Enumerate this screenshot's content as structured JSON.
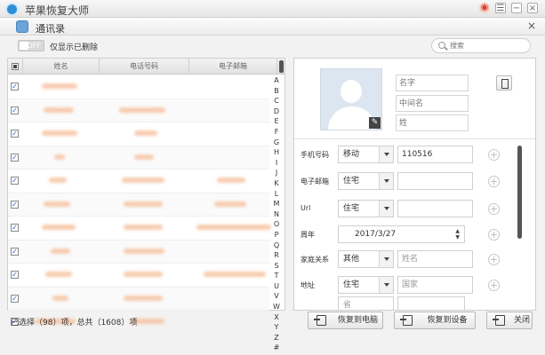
{
  "app": {
    "title": "苹果恢复大师",
    "logo": "app-logo-icon"
  },
  "titlebar": {
    "icons": [
      "weibo-icon",
      "feedback-icon",
      "minimize-icon",
      "close-icon"
    ]
  },
  "subheader": {
    "title": "通讯录",
    "close": "×"
  },
  "filter": {
    "toggle_text": "OFF",
    "label": "仅显示已删除",
    "search_placeholder": "搜索"
  },
  "list": {
    "columns": [
      "姓名",
      "电话号码",
      "电子邮箱"
    ],
    "alphabet": [
      "A",
      "B",
      "C",
      "D",
      "E",
      "F",
      "G",
      "H",
      "I",
      "J",
      "K",
      "L",
      "M",
      "N",
      "O",
      "P",
      "Q",
      "R",
      "S",
      "T",
      "U",
      "V",
      "W",
      "X",
      "Y",
      "Z",
      "#"
    ],
    "rows_checked": [
      true,
      true,
      true,
      true,
      true,
      true,
      true,
      true,
      true,
      true,
      true
    ]
  },
  "status": {
    "selection_text": "已选择（98）项，总共（1608）项"
  },
  "buttons": {
    "restore_pc": "恢复到电脑",
    "restore_device": "恢复到设备",
    "close": "关闭"
  },
  "detail": {
    "name_placeholders": {
      "first": "名字",
      "middle": "中间名",
      "last": "姓"
    },
    "phone": {
      "label": "手机号码",
      "type": "移动",
      "value": "110516"
    },
    "email": {
      "label": "电子邮箱",
      "type": "住宅"
    },
    "url": {
      "label": "Url",
      "type": "住宅"
    },
    "anniversary": {
      "label": "周年",
      "value": "2017/3/27"
    },
    "family": {
      "label": "家庭关系",
      "type": "其他",
      "placeholder": "姓名"
    },
    "address": {
      "label": "地址",
      "type": "住宅",
      "country_placeholder": "国家",
      "province_placeholder": "省"
    },
    "add_symbol": "+"
  }
}
